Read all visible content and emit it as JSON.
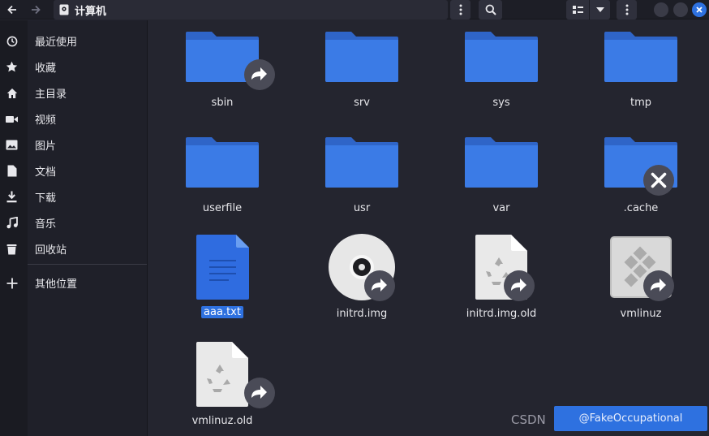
{
  "window": {
    "title": "计算机"
  },
  "sidebar": {
    "items": [
      {
        "label": "最近使用",
        "icon": "clock-icon"
      },
      {
        "label": "收藏",
        "icon": "star-icon"
      },
      {
        "label": "主目录",
        "icon": "home-icon"
      },
      {
        "label": "视频",
        "icon": "video-icon"
      },
      {
        "label": "图片",
        "icon": "image-icon"
      },
      {
        "label": "文档",
        "icon": "document-icon"
      },
      {
        "label": "下载",
        "icon": "download-icon"
      },
      {
        "label": "音乐",
        "icon": "music-icon"
      },
      {
        "label": "回收站",
        "icon": "trash-icon"
      },
      {
        "label": "其他位置",
        "icon": "plus-icon"
      }
    ]
  },
  "files": [
    {
      "name": "sbin",
      "type": "folder",
      "emblem": "symlink"
    },
    {
      "name": "srv",
      "type": "folder"
    },
    {
      "name": "sys",
      "type": "folder"
    },
    {
      "name": "tmp",
      "type": "folder"
    },
    {
      "name": "userfile",
      "type": "folder"
    },
    {
      "name": "usr",
      "type": "folder"
    },
    {
      "name": "var",
      "type": "folder"
    },
    {
      "name": ".cache",
      "type": "folder",
      "emblem": "unreadable"
    },
    {
      "name": "aaa.txt",
      "type": "text",
      "selected": true
    },
    {
      "name": "initrd.img",
      "type": "disc",
      "emblem": "symlink"
    },
    {
      "name": "initrd.img.old",
      "type": "generic",
      "emblem": "symlink"
    },
    {
      "name": "vmlinuz",
      "type": "executable",
      "emblem": "symlink"
    },
    {
      "name": "vmlinuz.old",
      "type": "generic",
      "emblem": "symlink"
    }
  ],
  "watermark": {
    "site": "CSDN",
    "author": "@FakeOccupational"
  },
  "colors": {
    "accent": "#2e71e0",
    "folder": "#3b7be6",
    "folder_tab": "#2f65c8",
    "background": "#24252f",
    "sidebar": "#1f2029"
  }
}
